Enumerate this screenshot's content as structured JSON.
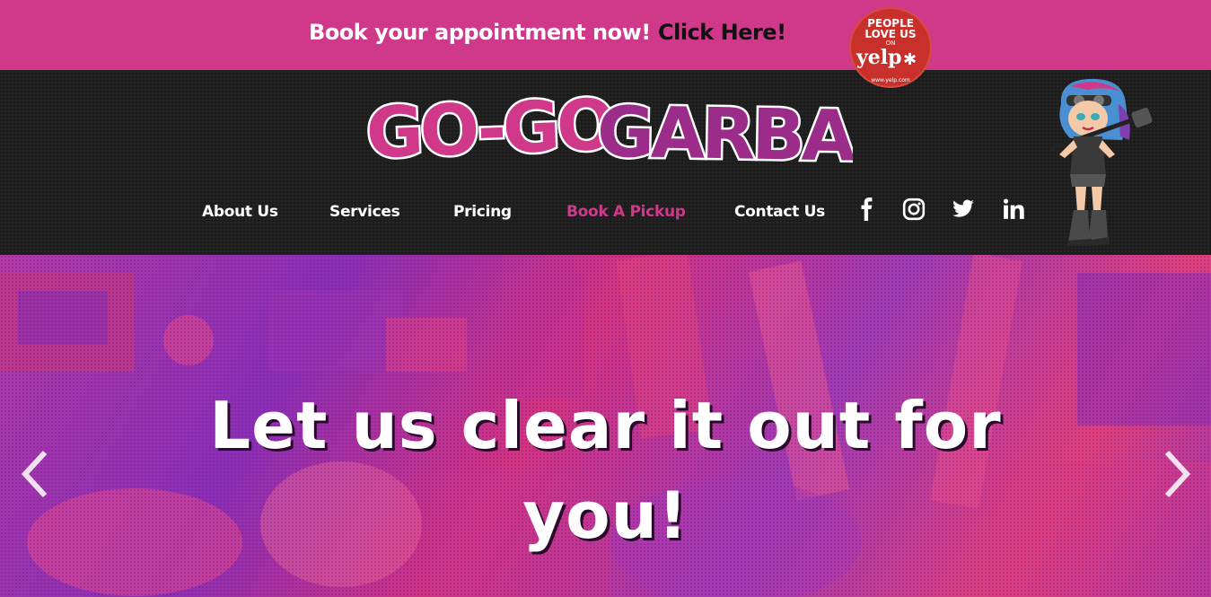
{
  "promo": {
    "text": "Book your appointment now!",
    "link_label": "Click Here!"
  },
  "yelp_badge": {
    "line1": "PEOPLE",
    "line2": "LOVE US",
    "line3": "ON",
    "brand": "yelp",
    "url": "www.yelp.com"
  },
  "header": {
    "logo_text": "GO-GO GARBAGE",
    "nav": [
      {
        "label": "About Us"
      },
      {
        "label": "Services"
      },
      {
        "label": "Pricing"
      },
      {
        "label": "Book A Pickup",
        "active": true
      },
      {
        "label": "Contact Us"
      }
    ],
    "social_icons": [
      "facebook-icon",
      "instagram-icon",
      "twitter-icon",
      "linkedin-icon"
    ]
  },
  "hero": {
    "title": "Let us clear it out for you!",
    "prev_icon": "chevron-left-icon",
    "next_icon": "chevron-right-icon"
  },
  "colors": {
    "brand_pink": "#d0388a",
    "header_bg": "#1d1d1d",
    "logo_purple": "#9b2c8a"
  }
}
